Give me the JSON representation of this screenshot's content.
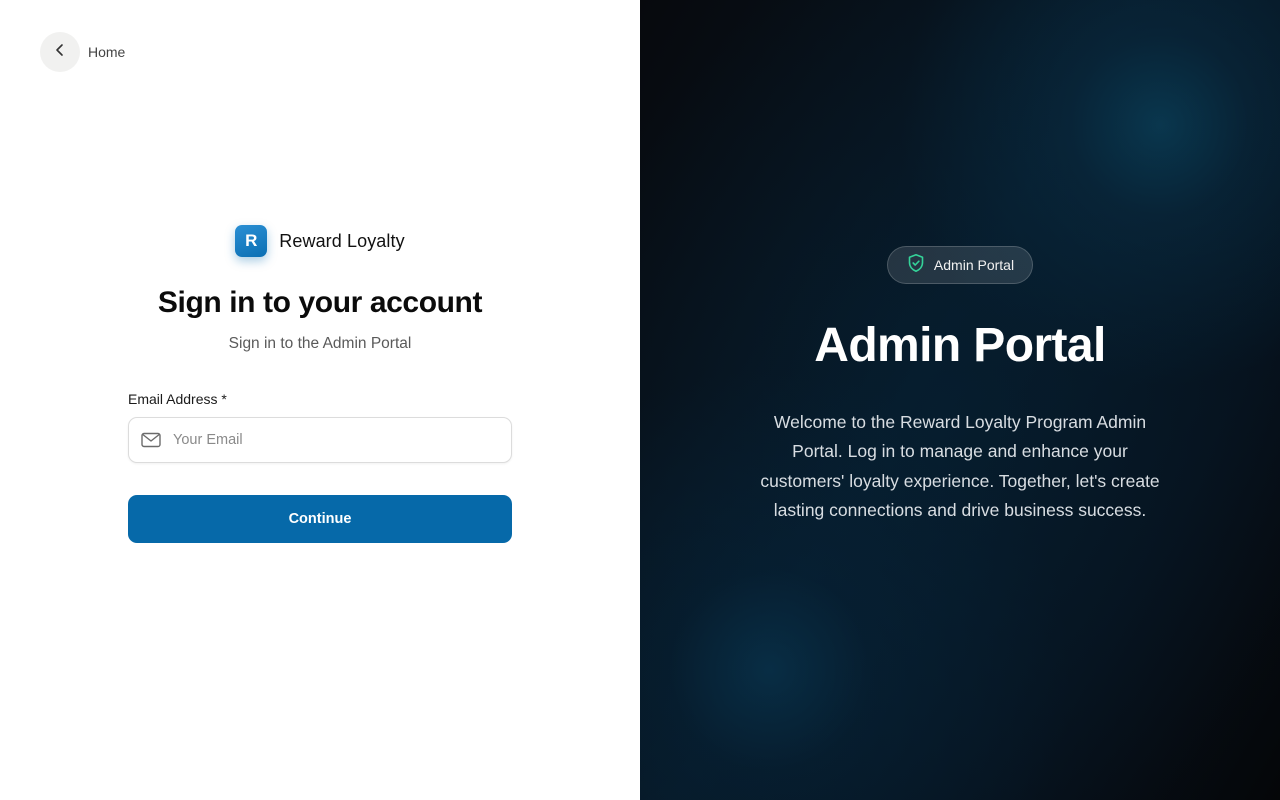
{
  "nav": {
    "back_label": "Home"
  },
  "brand": {
    "logo_letter": "R",
    "name": "Reward Loyalty"
  },
  "form": {
    "title": "Sign in to your account",
    "subtitle": "Sign in to the Admin Portal",
    "email_label": "Email Address *",
    "email_placeholder": "Your Email",
    "email_value": "",
    "submit_label": "Continue"
  },
  "hero": {
    "badge_label": "Admin Portal",
    "title": "Admin Portal",
    "description": "Welcome to the Reward Loyalty Program Admin Portal. Log in to manage and enhance your customers' loyalty experience. Together, let's create lasting connections and drive business success."
  },
  "icons": {
    "back": "chevron-left-icon",
    "email": "mail-icon",
    "badge": "shield-check-icon"
  },
  "colors": {
    "primary": "#0669a9",
    "badge_icon": "#34d399",
    "hero_bg": "#06111c"
  }
}
